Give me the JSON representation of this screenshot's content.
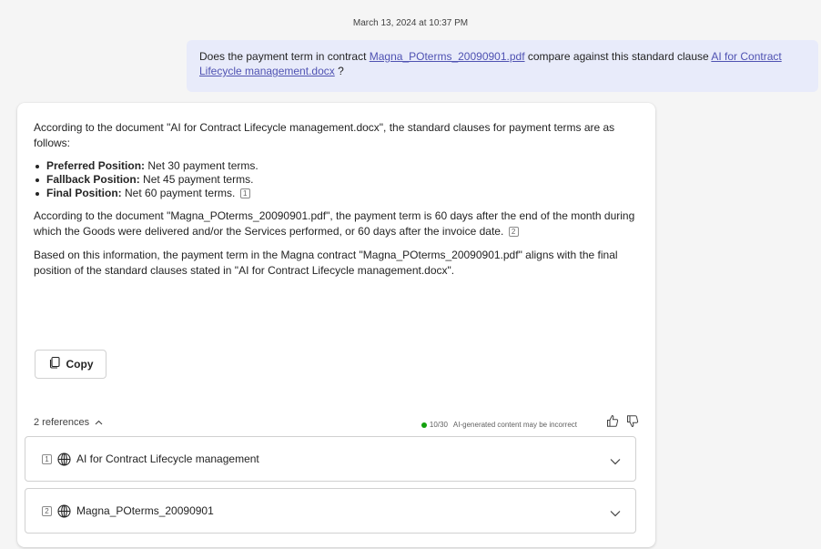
{
  "timestamp": "March 13, 2024 at 10:37 PM",
  "user_message": {
    "prefix": "Does the payment term in contract ",
    "link1": "Magna_POterms_20090901.pdf",
    "middle": " compare against this standard clause ",
    "link2": "AI for Contract Lifecycle management.docx",
    "suffix": " ?"
  },
  "response": {
    "intro": "According to the document \"AI for Contract Lifecycle management.docx\", the standard clauses for payment terms are as follows:",
    "bullets": [
      {
        "label": "Preferred Position:",
        "text": " Net 30 payment terms."
      },
      {
        "label": "Fallback Position:",
        "text": " Net 45 payment terms."
      },
      {
        "label": "Final Position:",
        "text": " Net 60 payment terms.",
        "citation": "1"
      }
    ],
    "para2": "According to the document \"Magna_POterms_20090901.pdf\", the payment term is 60 days after the end of the month during which the Goods were delivered and/or the Services performed, or 60 days after the invoice date.",
    "para2_citation": "2",
    "para3": "Based on this information, the payment term in the Magna contract \"Magna_POterms_20090901.pdf\" aligns with the final position of the standard clauses stated in \"AI for Contract Lifecycle management.docx\"."
  },
  "copy_label": "Copy",
  "references_label": "2 references",
  "usage_count": "10/30",
  "disclaimer": "AI-generated content may be incorrect",
  "references": [
    {
      "num": "1",
      "title": "AI for Contract Lifecycle management"
    },
    {
      "num": "2",
      "title": "Magna_POterms_20090901"
    }
  ],
  "colors": {
    "accent": "#4f52b2",
    "user_bubble": "#e8ebfa",
    "status_dot": "#13a10e"
  },
  "icons": {
    "copy": "copy-icon",
    "chevron_up": "chevron-up-icon",
    "thumbs_up": "thumbs-up-icon",
    "thumbs_down": "thumbs-down-icon",
    "globe": "globe-icon",
    "chevron_down": "chevron-down-icon"
  }
}
